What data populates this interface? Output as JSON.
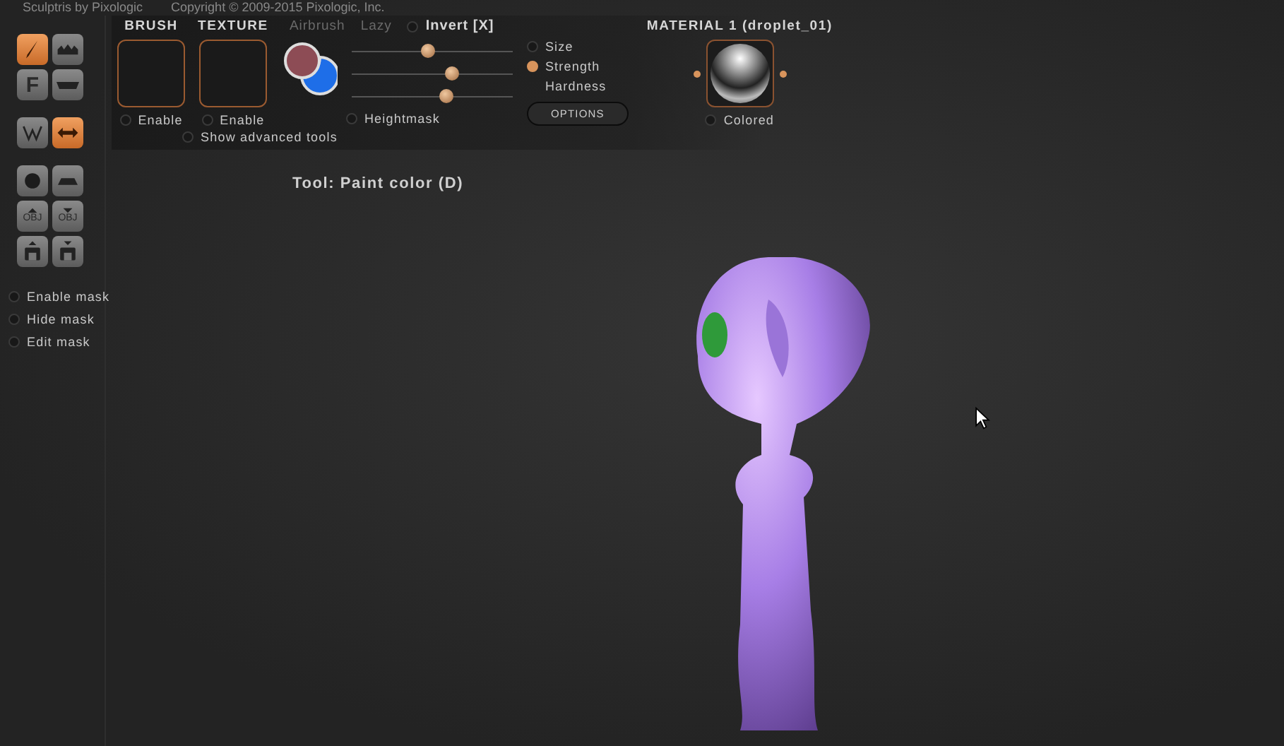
{
  "title_bar": {
    "app": "Sculptris by Pixologic",
    "copyright": "Copyright © 2009-2015 Pixologic, Inc."
  },
  "tools": [
    {
      "selected": true
    },
    {
      "selected": false
    },
    {
      "label": "F",
      "selected": false
    },
    {
      "selected": false
    },
    {
      "selected": false
    },
    {
      "selected": true
    },
    {
      "selected": false
    },
    {
      "selected": false
    },
    {
      "label": "OBJ",
      "selected": false
    },
    {
      "label": "OBJ",
      "selected": false
    },
    {
      "selected": false
    },
    {
      "selected": false
    }
  ],
  "mask_options": [
    {
      "label": "Enable mask",
      "on": false
    },
    {
      "label": "Hide mask",
      "on": false
    },
    {
      "label": "Edit mask",
      "on": false
    }
  ],
  "brush": {
    "title": "BRUSH",
    "enable": {
      "label": "Enable",
      "on": false
    }
  },
  "texture": {
    "title": "TEXTURE",
    "enable": {
      "label": "Enable",
      "on": false
    }
  },
  "airbrush": {
    "label": "Airbrush",
    "disabled": true
  },
  "lazy": {
    "label": "Lazy",
    "disabled": true
  },
  "invert": {
    "label": "Invert [X]",
    "on": false
  },
  "colors": [
    {
      "color": "#8d4c55"
    },
    {
      "color": "#1e6ee8"
    }
  ],
  "sliders": [
    {
      "label": "Size",
      "kind": "radio",
      "selected": false,
      "level": 0.47
    },
    {
      "label": "Strength",
      "kind": "radio",
      "selected": true,
      "level": 0.62
    },
    {
      "label": "Hardness",
      "kind": "plain",
      "level": 0.59
    }
  ],
  "heightmask": {
    "label": "Heightmask",
    "on": false
  },
  "options_button": "OPTIONS",
  "material": {
    "title": "MATERIAL 1 (droplet_01)",
    "colored": {
      "label": "Colored",
      "on": false
    }
  },
  "show_advanced": {
    "label": "Show advanced tools",
    "on": false
  },
  "status": "Tool: Paint color (D)"
}
